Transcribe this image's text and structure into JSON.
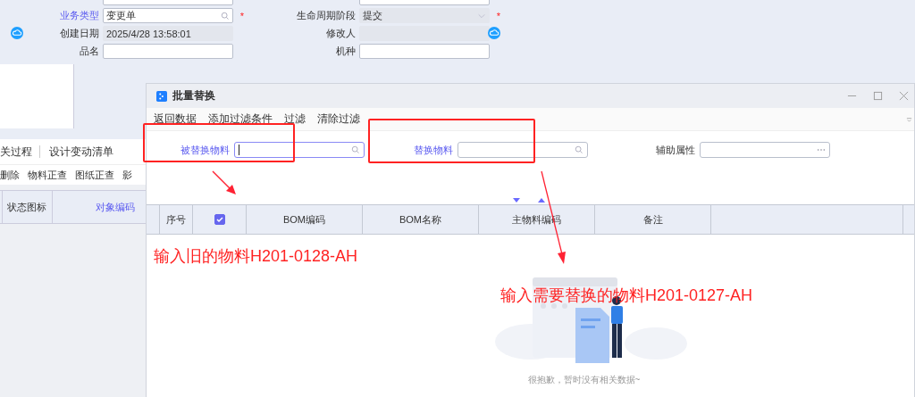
{
  "form": {
    "rows": [
      {
        "sync": false,
        "cells": [
          {
            "label": "业务类型",
            "link": true,
            "value": "变更单",
            "kind": "lookup",
            "required_mark": "*"
          },
          {
            "label": "生命周期阶段",
            "link": false,
            "value": "提交",
            "kind": "select",
            "required_mark": "*"
          }
        ]
      },
      {
        "sync": true,
        "cells": [
          {
            "label": "创建日期",
            "link": false,
            "value": "2025/4/28 13:58:01",
            "kind": "readonly"
          },
          {
            "label": "修改人",
            "link": false,
            "kind": "readonly"
          }
        ]
      },
      {
        "sync": false,
        "cells": [
          {
            "label": "品名",
            "link": false,
            "kind": "text"
          },
          {
            "label": "机种",
            "link": false,
            "kind": "text"
          }
        ]
      }
    ]
  },
  "left_panel": {
    "tabs": [
      "关过程",
      "设计变动清单"
    ],
    "toolbar": [
      "删除",
      "物料正查",
      "图纸正查",
      "影"
    ],
    "columns": [
      {
        "label": "状态图标",
        "link": false
      },
      {
        "label": "对象编码",
        "link": true
      }
    ]
  },
  "dialog": {
    "title": "批量替换",
    "menu": [
      "返回数据",
      "添加过滤条件",
      "过滤",
      "清除过滤"
    ],
    "filters": [
      {
        "label": "被替换物料",
        "link": true,
        "kind": "lookup",
        "focused": true
      },
      {
        "label": "替换物料",
        "link": true,
        "kind": "lookup",
        "focused": false
      },
      {
        "label": "辅助属性",
        "link": false,
        "kind": "ellipsis",
        "focused": false
      }
    ],
    "columns": [
      {
        "kind": "text",
        "label": "序号"
      },
      {
        "kind": "checkbox",
        "checked": true
      },
      {
        "kind": "text",
        "label": "BOM编码"
      },
      {
        "kind": "text",
        "label": "BOM名称"
      },
      {
        "kind": "text",
        "label": "主物料编码"
      },
      {
        "kind": "text",
        "label": "备注"
      }
    ],
    "empty_text": "很抱歉，暂时没有相关数据~"
  },
  "annotations": [
    "输入旧的物料H201-0128-AH",
    "输入需要替换的物料H201-0127-AH"
  ]
}
